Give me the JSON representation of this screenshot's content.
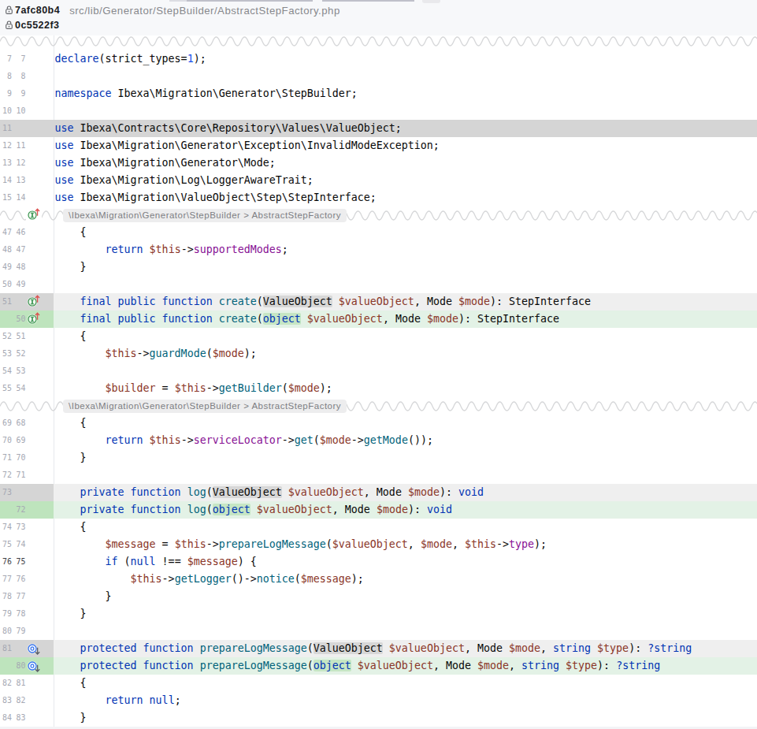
{
  "header": {
    "revisions": [
      {
        "hash": "7afc80b4",
        "path": "src/lib/Generator/StepBuilder/AbstractStepFactory.php"
      },
      {
        "hash": "0c5522f3",
        "path": ""
      }
    ]
  },
  "breadcrumb": {
    "text": "\\Ibexa\\Migration\\Generator\\StepBuilder > AbstractStepFactory"
  },
  "colors": {
    "header_bg": "#f7f8fa",
    "deleted_line_bg": "#d5d5d5",
    "modified_deleted_gutter_bg": "#d5d5d5",
    "modified_deleted_line_bg": "#efefef",
    "modified_deleted_word_bg": "#d7d7d7",
    "added_gutter_bg": "#bee4bd",
    "added_line_bg": "#e3f2e6",
    "added_word_bg": "#c6e6c4",
    "keyword": "#0033b3",
    "function": "#00627a",
    "field": "#871094",
    "variable": "#8a3527",
    "number": "#1750eb",
    "line_number": "#a5a8b3"
  },
  "code": {
    "rows": [
      {
        "o": "7",
        "n": "7",
        "t": "ctx",
        "tk": [
          [
            "kw",
            "declare"
          ],
          [
            "pl",
            "(strict_types="
          ],
          [
            "num",
            "1"
          ],
          [
            "pl",
            ");"
          ]
        ]
      },
      {
        "o": "8",
        "n": "8",
        "t": "ctx",
        "tk": []
      },
      {
        "o": "9",
        "n": "9",
        "t": "ctx",
        "tk": [
          [
            "kw",
            "namespace"
          ],
          [
            "pl",
            " Ibexa\\Migration\\Generator\\StepBuilder;"
          ]
        ]
      },
      {
        "o": "10",
        "n": "10",
        "t": "ctx",
        "tk": []
      },
      {
        "o": "11",
        "n": "",
        "t": "del",
        "tk": [
          [
            "kw",
            "use"
          ],
          [
            "pl",
            " Ibexa\\Contracts\\Core\\Repository\\Values\\ValueObject;"
          ]
        ]
      },
      {
        "o": "12",
        "n": "11",
        "t": "ctx",
        "tk": [
          [
            "kw",
            "use"
          ],
          [
            "pl",
            " Ibexa\\Migration\\Generator\\Exception\\InvalidModeException;"
          ]
        ]
      },
      {
        "o": "13",
        "n": "12",
        "t": "ctx",
        "tk": [
          [
            "kw",
            "use"
          ],
          [
            "pl",
            " Ibexa\\Migration\\Generator\\Mode;"
          ]
        ]
      },
      {
        "o": "14",
        "n": "13",
        "t": "ctx",
        "tk": [
          [
            "kw",
            "use"
          ],
          [
            "pl",
            " Ibexa\\Migration\\Log\\LoggerAwareTrait;"
          ]
        ]
      },
      {
        "o": "15",
        "n": "14",
        "t": "ctx",
        "tk": [
          [
            "kw",
            "use"
          ],
          [
            "pl",
            " Ibexa\\Migration\\ValueObject\\Step\\StepInterface;"
          ]
        ]
      },
      {
        "t": "sep",
        "icon": "implements"
      },
      {
        "o": "47",
        "n": "46",
        "t": "ctx",
        "tk": [
          [
            "pl",
            "    {"
          ]
        ]
      },
      {
        "o": "48",
        "n": "47",
        "t": "ctx",
        "tk": [
          [
            "pl",
            "        "
          ],
          [
            "kw",
            "return"
          ],
          [
            "pl",
            " "
          ],
          [
            "var",
            "$this"
          ],
          [
            "pl",
            "->"
          ],
          [
            "fld",
            "supportedModes"
          ],
          [
            "pl",
            ";"
          ]
        ]
      },
      {
        "o": "49",
        "n": "48",
        "t": "ctx",
        "tk": [
          [
            "pl",
            "    }"
          ]
        ]
      },
      {
        "o": "50",
        "n": "49",
        "t": "ctx",
        "tk": []
      },
      {
        "o": "51",
        "n": "",
        "t": "delmod",
        "icon": "implements",
        "tk": [
          [
            "pl",
            "    "
          ],
          [
            "kw",
            "final public function"
          ],
          [
            "pl",
            " "
          ],
          [
            "fn",
            "create"
          ],
          [
            "pl",
            "("
          ],
          [
            "cls",
            "ValueObject",
            "h"
          ],
          [
            "pl",
            " "
          ],
          [
            "var",
            "$valueObject"
          ],
          [
            "pl",
            ", "
          ],
          [
            "cls",
            "Mode"
          ],
          [
            "pl",
            " "
          ],
          [
            "var",
            "$mode"
          ],
          [
            "pl",
            "): "
          ],
          [
            "cls",
            "StepInterface"
          ]
        ]
      },
      {
        "o": "",
        "n": "50",
        "t": "addmod",
        "icon": "implements",
        "tk": [
          [
            "pl",
            "    "
          ],
          [
            "kw",
            "final public function"
          ],
          [
            "pl",
            " "
          ],
          [
            "fn",
            "create"
          ],
          [
            "pl",
            "("
          ],
          [
            "kw",
            "object",
            "h"
          ],
          [
            "pl",
            " "
          ],
          [
            "var",
            "$valueObject"
          ],
          [
            "pl",
            ", "
          ],
          [
            "cls",
            "Mode"
          ],
          [
            "pl",
            " "
          ],
          [
            "var",
            "$mode"
          ],
          [
            "pl",
            "): "
          ],
          [
            "cls",
            "StepInterface"
          ]
        ]
      },
      {
        "o": "52",
        "n": "51",
        "t": "ctx",
        "tk": [
          [
            "pl",
            "    {"
          ]
        ]
      },
      {
        "o": "53",
        "n": "52",
        "t": "ctx",
        "tk": [
          [
            "pl",
            "        "
          ],
          [
            "var",
            "$this"
          ],
          [
            "pl",
            "->"
          ],
          [
            "fn",
            "guardMode"
          ],
          [
            "pl",
            "("
          ],
          [
            "var",
            "$mode"
          ],
          [
            "pl",
            ");"
          ]
        ]
      },
      {
        "o": "54",
        "n": "53",
        "t": "ctx",
        "tk": []
      },
      {
        "o": "55",
        "n": "54",
        "t": "ctx",
        "tk": [
          [
            "pl",
            "        "
          ],
          [
            "var",
            "$builder"
          ],
          [
            "pl",
            " = "
          ],
          [
            "var",
            "$this"
          ],
          [
            "pl",
            "->"
          ],
          [
            "fn",
            "getBuilder"
          ],
          [
            "pl",
            "("
          ],
          [
            "var",
            "$mode"
          ],
          [
            "pl",
            ");"
          ]
        ]
      },
      {
        "t": "sep"
      },
      {
        "o": "69",
        "n": "68",
        "t": "ctx",
        "tk": [
          [
            "pl",
            "    {"
          ]
        ]
      },
      {
        "o": "70",
        "n": "69",
        "t": "ctx",
        "tk": [
          [
            "pl",
            "        "
          ],
          [
            "kw",
            "return"
          ],
          [
            "pl",
            " "
          ],
          [
            "var",
            "$this"
          ],
          [
            "pl",
            "->"
          ],
          [
            "fld",
            "serviceLocator"
          ],
          [
            "pl",
            "->"
          ],
          [
            "fn",
            "get"
          ],
          [
            "pl",
            "("
          ],
          [
            "var",
            "$mode"
          ],
          [
            "pl",
            "->"
          ],
          [
            "fn",
            "getMode"
          ],
          [
            "pl",
            "());"
          ]
        ]
      },
      {
        "o": "71",
        "n": "70",
        "t": "ctx",
        "tk": [
          [
            "pl",
            "    }"
          ]
        ]
      },
      {
        "o": "72",
        "n": "71",
        "t": "ctx",
        "tk": []
      },
      {
        "o": "73",
        "n": "",
        "t": "delmod",
        "tk": [
          [
            "pl",
            "    "
          ],
          [
            "kw",
            "private function"
          ],
          [
            "pl",
            " "
          ],
          [
            "fn",
            "log"
          ],
          [
            "pl",
            "("
          ],
          [
            "cls",
            "ValueObject",
            "h"
          ],
          [
            "pl",
            " "
          ],
          [
            "var",
            "$valueObject"
          ],
          [
            "pl",
            ", "
          ],
          [
            "cls",
            "Mode"
          ],
          [
            "pl",
            " "
          ],
          [
            "var",
            "$mode"
          ],
          [
            "pl",
            "): "
          ],
          [
            "kw",
            "void"
          ]
        ]
      },
      {
        "o": "",
        "n": "72",
        "t": "addmod",
        "tk": [
          [
            "pl",
            "    "
          ],
          [
            "kw",
            "private function"
          ],
          [
            "pl",
            " "
          ],
          [
            "fn",
            "log"
          ],
          [
            "pl",
            "("
          ],
          [
            "kw",
            "object",
            "h"
          ],
          [
            "pl",
            " "
          ],
          [
            "var",
            "$valueObject"
          ],
          [
            "pl",
            ", "
          ],
          [
            "cls",
            "Mode"
          ],
          [
            "pl",
            " "
          ],
          [
            "var",
            "$mode"
          ],
          [
            "pl",
            "): "
          ],
          [
            "kw",
            "void"
          ]
        ]
      },
      {
        "o": "74",
        "n": "73",
        "t": "ctx",
        "tk": [
          [
            "pl",
            "    {"
          ]
        ]
      },
      {
        "o": "75",
        "n": "74",
        "t": "ctx",
        "tk": [
          [
            "pl",
            "        "
          ],
          [
            "var",
            "$message"
          ],
          [
            "pl",
            " = "
          ],
          [
            "var",
            "$this"
          ],
          [
            "pl",
            "->"
          ],
          [
            "fn",
            "prepareLogMessage"
          ],
          [
            "pl",
            "("
          ],
          [
            "var",
            "$valueObject"
          ],
          [
            "pl",
            ", "
          ],
          [
            "var",
            "$mode"
          ],
          [
            "pl",
            ", "
          ],
          [
            "var",
            "$this"
          ],
          [
            "pl",
            "->"
          ],
          [
            "fld",
            "type"
          ],
          [
            "pl",
            ");"
          ]
        ]
      },
      {
        "o": "76",
        "n": "75",
        "t": "ctx",
        "cur": true,
        "tk": [
          [
            "pl",
            "        "
          ],
          [
            "kw",
            "if"
          ],
          [
            "pl",
            " ("
          ],
          [
            "kw",
            "null"
          ],
          [
            "pl",
            " !== "
          ],
          [
            "var",
            "$message"
          ],
          [
            "pl",
            ") {"
          ]
        ]
      },
      {
        "o": "77",
        "n": "76",
        "t": "ctx",
        "tk": [
          [
            "pl",
            "            "
          ],
          [
            "var",
            "$this"
          ],
          [
            "pl",
            "->"
          ],
          [
            "fn",
            "getLogger"
          ],
          [
            "pl",
            "()->"
          ],
          [
            "fn",
            "notice"
          ],
          [
            "pl",
            "("
          ],
          [
            "var",
            "$message"
          ],
          [
            "pl",
            ");"
          ]
        ]
      },
      {
        "o": "78",
        "n": "77",
        "t": "ctx",
        "tk": [
          [
            "pl",
            "        }"
          ]
        ]
      },
      {
        "o": "79",
        "n": "78",
        "t": "ctx",
        "tk": [
          [
            "pl",
            "    }"
          ]
        ]
      },
      {
        "o": "80",
        "n": "79",
        "t": "ctx",
        "tk": []
      },
      {
        "o": "81",
        "n": "",
        "t": "delmod",
        "icon": "overridden",
        "tk": [
          [
            "pl",
            "    "
          ],
          [
            "kw",
            "protected function"
          ],
          [
            "pl",
            " "
          ],
          [
            "fn",
            "prepareLogMessage"
          ],
          [
            "pl",
            "("
          ],
          [
            "cls",
            "ValueObject",
            "h"
          ],
          [
            "pl",
            " "
          ],
          [
            "var",
            "$valueObject"
          ],
          [
            "pl",
            ", "
          ],
          [
            "cls",
            "Mode"
          ],
          [
            "pl",
            " "
          ],
          [
            "var",
            "$mode"
          ],
          [
            "pl",
            ", "
          ],
          [
            "kw",
            "string"
          ],
          [
            "pl",
            " "
          ],
          [
            "var",
            "$type"
          ],
          [
            "pl",
            "): "
          ],
          [
            "kw",
            "?string"
          ]
        ]
      },
      {
        "o": "",
        "n": "80",
        "t": "addmod",
        "icon": "overridden",
        "tk": [
          [
            "pl",
            "    "
          ],
          [
            "kw",
            "protected function"
          ],
          [
            "pl",
            " "
          ],
          [
            "fn",
            "prepareLogMessage"
          ],
          [
            "pl",
            "("
          ],
          [
            "kw",
            "object",
            "h"
          ],
          [
            "pl",
            " "
          ],
          [
            "var",
            "$valueObject"
          ],
          [
            "pl",
            ", "
          ],
          [
            "cls",
            "Mode"
          ],
          [
            "pl",
            " "
          ],
          [
            "var",
            "$mode"
          ],
          [
            "pl",
            ", "
          ],
          [
            "kw",
            "string"
          ],
          [
            "pl",
            " "
          ],
          [
            "var",
            "$type"
          ],
          [
            "pl",
            "): "
          ],
          [
            "kw",
            "?string"
          ]
        ]
      },
      {
        "o": "82",
        "n": "81",
        "t": "ctx",
        "tk": [
          [
            "pl",
            "    {"
          ]
        ]
      },
      {
        "o": "83",
        "n": "82",
        "t": "ctx",
        "tk": [
          [
            "pl",
            "        "
          ],
          [
            "kw",
            "return"
          ],
          [
            "pl",
            " "
          ],
          [
            "kw",
            "null"
          ],
          [
            "pl",
            ";"
          ]
        ]
      },
      {
        "o": "84",
        "n": "83",
        "t": "ctx",
        "tk": [
          [
            "pl",
            "    }"
          ]
        ]
      }
    ]
  }
}
